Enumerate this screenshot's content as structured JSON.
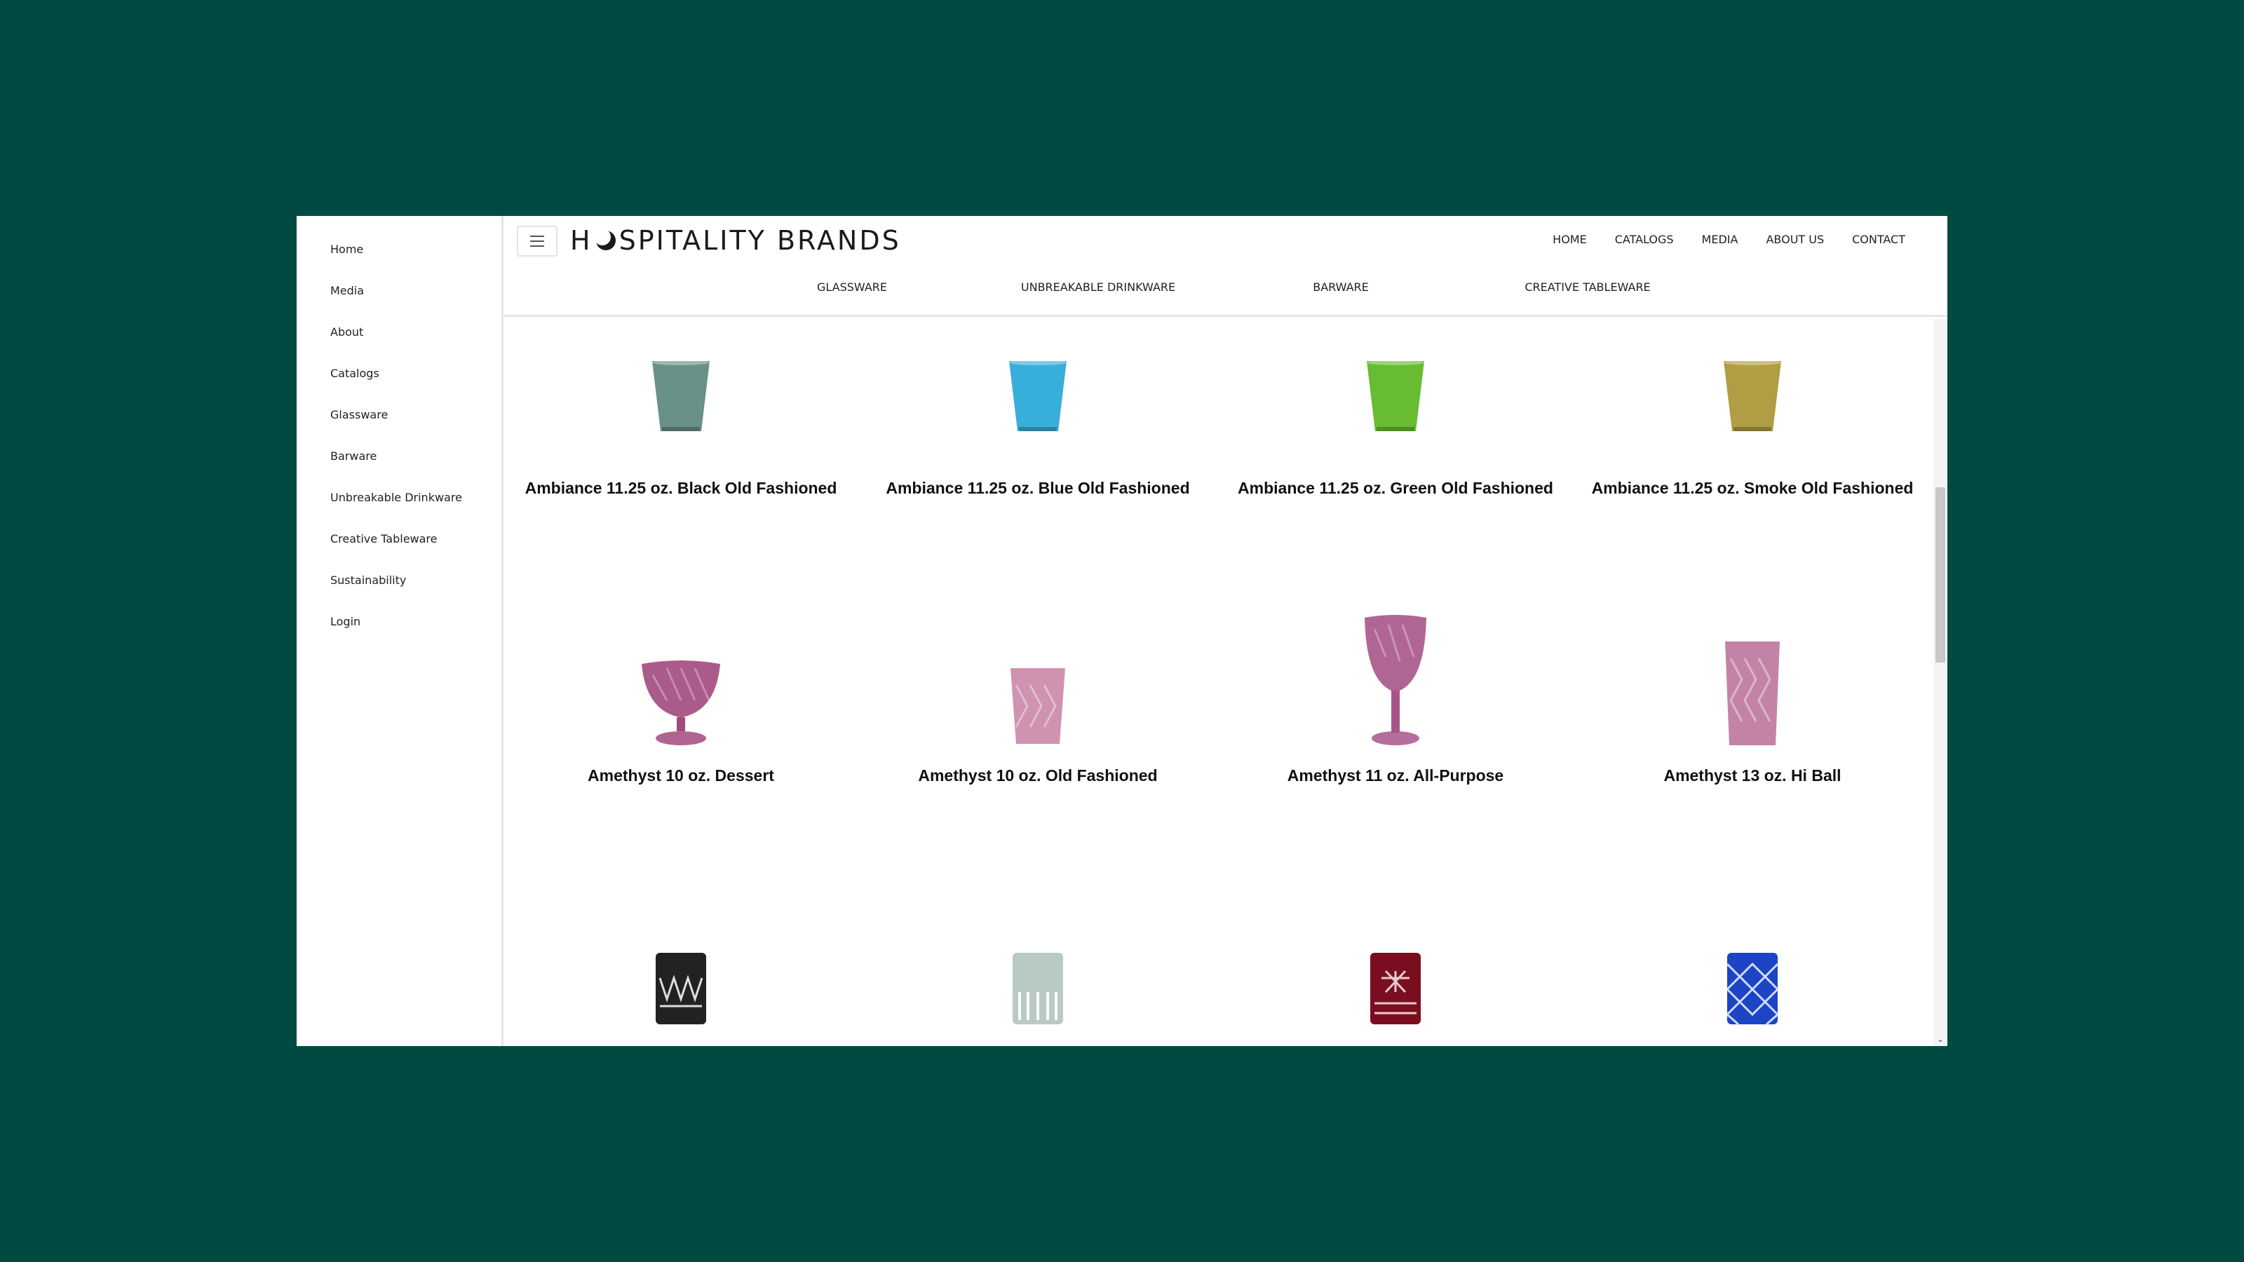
{
  "sidebar": {
    "items": [
      {
        "label": "Home"
      },
      {
        "label": "Media"
      },
      {
        "label": "About"
      },
      {
        "label": "Catalogs"
      },
      {
        "label": "Glassware"
      },
      {
        "label": "Barware"
      },
      {
        "label": "Unbreakable Drinkware"
      },
      {
        "label": "Creative Tableware"
      },
      {
        "label": "Sustainability"
      },
      {
        "label": "Login"
      }
    ]
  },
  "header": {
    "logo_prefix": "H",
    "logo_suffix": "SPITALITY BRANDS",
    "nav": [
      {
        "label": "HOME"
      },
      {
        "label": "CATALOGS"
      },
      {
        "label": "MEDIA"
      },
      {
        "label": "ABOUT US"
      },
      {
        "label": "CONTACT"
      }
    ],
    "sub_nav": [
      {
        "label": "GLASSWARE"
      },
      {
        "label": "UNBREAKABLE DRINKWARE"
      },
      {
        "label": "BARWARE"
      },
      {
        "label": "CREATIVE TABLEWARE"
      }
    ]
  },
  "products": [
    {
      "name": "Ambiance 11.25 oz. Black Old Fashioned",
      "color": "#4f7d72"
    },
    {
      "name": "Ambiance 11.25 oz. Blue Old Fashioned",
      "color": "#22a6d6"
    },
    {
      "name": "Ambiance 11.25 oz. Green Old Fashioned",
      "color": "#56b51c"
    },
    {
      "name": "Ambiance 11.25 oz. Smoke Old Fashioned",
      "color": "#a8922f"
    },
    {
      "name": "Amethyst 10 oz. Dessert",
      "color": "#a2497d"
    },
    {
      "name": "Amethyst 10 oz. Old Fashioned",
      "color": "#c77fa3"
    },
    {
      "name": "Amethyst 11 oz. All-Purpose",
      "color": "#a75589"
    },
    {
      "name": "Amethyst 13 oz. Hi Ball",
      "color": "#b96d98"
    },
    {
      "name": "",
      "color": "#222222"
    },
    {
      "name": "",
      "color": "#b9cac4"
    },
    {
      "name": "",
      "color": "#7a0e1f"
    },
    {
      "name": "",
      "color": "#1c44c4"
    }
  ]
}
